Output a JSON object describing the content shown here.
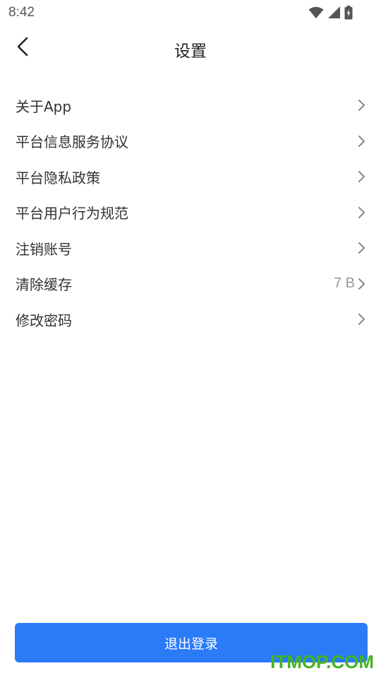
{
  "status_bar": {
    "time": "8:42"
  },
  "header": {
    "title": "设置"
  },
  "settings": {
    "items": [
      {
        "label": "关于App",
        "value": ""
      },
      {
        "label": "平台信息服务协议",
        "value": ""
      },
      {
        "label": "平台隐私政策",
        "value": ""
      },
      {
        "label": "平台用户行为规范",
        "value": ""
      },
      {
        "label": "注销账号",
        "value": ""
      },
      {
        "label": "清除缓存",
        "value": "7 B"
      },
      {
        "label": "修改密码",
        "value": ""
      }
    ]
  },
  "footer": {
    "logout_label": "退出登录"
  },
  "watermark": {
    "text": "ITMOP.COM"
  },
  "colors": {
    "accent": "#2b7bf7",
    "watermark": "#43b51f",
    "chevron": "#888888"
  },
  "icons": [
    "wifi-icon",
    "cell-signal-icon",
    "battery-charging-icon",
    "back-arrow-icon",
    "chevron-right-icon"
  ]
}
